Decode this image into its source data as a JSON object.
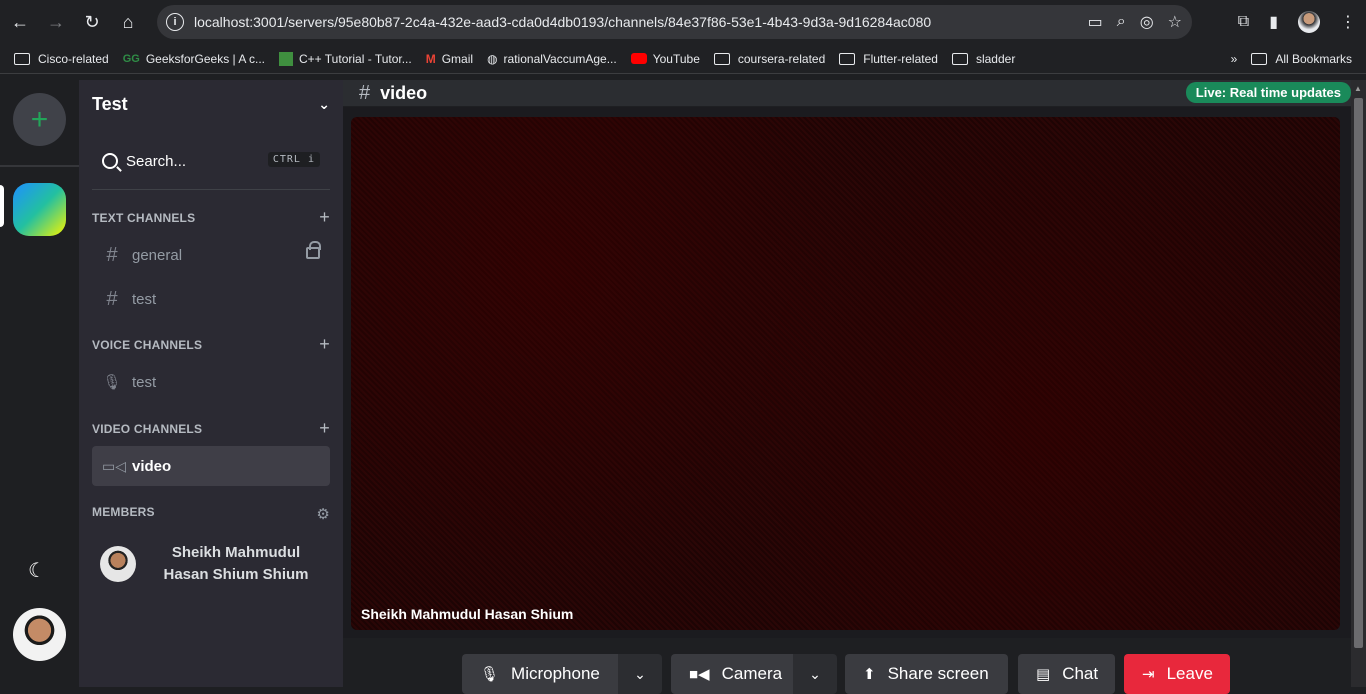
{
  "browser": {
    "url": "localhost:3001/servers/95e80b87-2c4a-432e-aad3-cda0d4db0193/channels/84e37f86-53e1-4b43-9d3a-9d16284ac080",
    "bookmarks": [
      {
        "label": "Cisco-related",
        "icon": "folder-icon"
      },
      {
        "label": "GeeksforGeeks | A c...",
        "icon": "gfg-icon"
      },
      {
        "label": "C++ Tutorial - Tutor...",
        "icon": "cpp-icon"
      },
      {
        "label": "Gmail",
        "icon": "gmail-icon"
      },
      {
        "label": "rationalVaccumAge...",
        "icon": "globe-icon"
      },
      {
        "label": "YouTube",
        "icon": "youtube-icon"
      },
      {
        "label": "coursera-related",
        "icon": "folder-icon"
      },
      {
        "label": "Flutter-related",
        "icon": "folder-icon"
      },
      {
        "label": "sladder",
        "icon": "folder-icon"
      }
    ],
    "all_bookmarks_label": "All Bookmarks"
  },
  "server": {
    "name": "Test",
    "search_label": "Search...",
    "search_shortcut": "CTRL",
    "search_shortcut_key": "i"
  },
  "sections": {
    "text": "TEXT CHANNELS",
    "voice": "VOICE CHANNELS",
    "video": "VIDEO CHANNELS",
    "members": "MEMBERS"
  },
  "channels": {
    "text": [
      {
        "name": "general",
        "locked": true
      },
      {
        "name": "test",
        "locked": false
      }
    ],
    "voice": [
      {
        "name": "test"
      }
    ],
    "video": [
      {
        "name": "video",
        "active": true
      }
    ]
  },
  "members": [
    {
      "name": "Sheikh Mahmudul Hasan Shium Shium"
    }
  ],
  "main": {
    "channel_name": "video",
    "live_badge": "Live: Real time updates",
    "participant_name": "Sheikh Mahmudul Hasan Shium"
  },
  "controls": {
    "microphone": "Microphone",
    "camera": "Camera",
    "share_screen": "Share screen",
    "chat": "Chat",
    "leave": "Leave"
  },
  "colors": {
    "add_server": "#23a559",
    "live_badge": "#1a8a5a",
    "leave": "#e8283c"
  }
}
